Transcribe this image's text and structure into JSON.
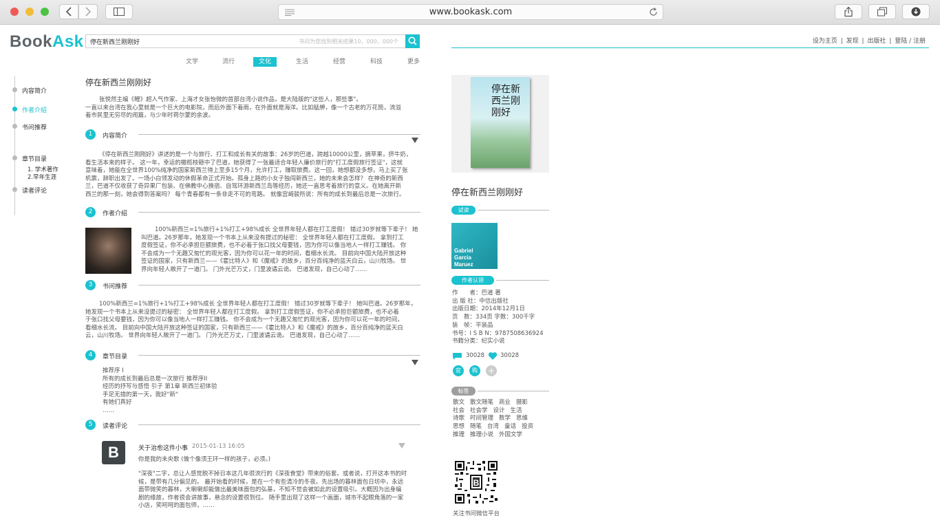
{
  "browser": {
    "url": "www.bookask.com"
  },
  "header": {
    "logo_book": "Book",
    "logo_ask": "Ask",
    "search_value": "停在新西兰刚刚好",
    "search_placeholder": "书问为您找到相关结果10，000，000个",
    "links": [
      "设为主页",
      "发现",
      "出版社",
      "登陆 / 注册"
    ],
    "separator": "|"
  },
  "categories": {
    "items": [
      "文学",
      "流行",
      "文化",
      "生活",
      "经营",
      "科技",
      "更多"
    ],
    "active_index": 2
  },
  "sidenav": {
    "items": [
      "内容简介",
      "作者介绍",
      "书问推荐",
      "章节目录",
      "1. 学术著作",
      "2.早年生涯",
      "读者评论"
    ],
    "active_index": 1
  },
  "book": {
    "title": "停在新西兰刚刚好",
    "intro": "张悦然主编《鲤》超人气作家、上海才女张怡微的首部台湾小说作品，是大陆版的\"这些人，那些事\"。",
    "intro_2": "一直以来台湾在我心里就是一个巨大的电影院，而后外面下着雨，在外面就是海洋。比如艋舺，像一个古老的万花筒，流溢",
    "intro_3": "着市民里无穷尽的闹篇，与少年时荷尔蒙的余波。"
  },
  "sections": {
    "s1": {
      "num": "1",
      "title": "内容简介",
      "lines": [
        "《停在新西兰刚刚好》讲述的是一个与旅行、打工和成长有关的故事：26岁的巴道，跨越10000公里，摘苹果，挤牛奶，",
        "看生活本来的样子。 这一年，幸运的橄榄枝砸中了巴道，她获得了一张最适合年轻人廉价旅行的\"打工度假旅行签证\"，这就",
        "意味着，她能在全世界100%纯净的国家新西兰待上至多15个月，允许打工，赚取旅费。这一回，她想都没多想，马上买了张",
        "机票，辞职出发了。一场小白领发动的休假革命正式开始。孤身上路的小女子独闯新西兰，她的未来会怎样？ 在神奇的新西",
        "兰，巴道不仅收获了奇异果厂包装、在佛教中心换宿、自驾环游新西兰岛等经历，她还一直思考着旅行的意义。在她离开新",
        "西兰的那一刻，她会得到答案吗？ 每个青春都有一条非走不可的弯路。 就像宫崎骏所说：所有的成长到最后总是一次旅行。"
      ]
    },
    "s2": {
      "num": "2",
      "title": "作者介绍",
      "lines": [
        "100%新西兰=1%旅行+1%打工+98%成长 全世界年轻人都在打工度假！ 错过30岁就等下辈子！ 她",
        "叫巴道。26岁那年，她发现一个书本上从来没有提过的秘密： 全世界年轻人都在打工度假。 拿到打工",
        "度假签证，你不必承担巨额旅费，也不必着于张口找父母要钱，因为你可以像当地人一样打工赚钱。 你",
        "不会成为一个无趣又匆忙的观光客，因为你可以花一年的时间，看细水长流。 目前向中国大陆开放这种",
        "签证的国家，只有新西兰——《霍比特人》和《魔戒》的故乡，百分百纯净的蓝天白云，山川牧场。 世",
        "界向年轻人敞开了一道门。 门外光芒万丈，门里波谲云诡。 巴道发现，自己心动了……"
      ]
    },
    "s3": {
      "num": "3",
      "title": "书问推荐",
      "lines": [
        "100%新西兰=1%旅行+1%打工+98%成长 全世界年轻人都在打工度假！ 错过30岁就等下辈子！ 她叫巴道。26岁那年，",
        "她发现一个书本上从来没提过的秘密： 全世界年轻人都在打工度假。 拿到打工度假签证，你不必承担巨额旅费，也不必着",
        "于张口找父母要钱，因为你可以像当地人一样打工赚钱。 你不会成为一个无趣又匆忙的观光客，因为你可以花一年的时间，",
        "看细水长流。 目前向中国大陆开放这种签证的国家，只有新西兰——《霍比特人》和《魔戒》的故乡，百分百纯净的蓝天白",
        "云，山川牧场。 世界向年轻人敞开了一道门。 门外光芒万丈，门里波谲云诡。 巴道发现，自己心动了……"
      ]
    },
    "s4": {
      "num": "4",
      "title": "章节目录",
      "lines": [
        "推荐序 I",
        "所有的成长到最后总是一次旅行 推荐序II",
        "经历的抒写与感悟 引子 第1章 新西兰初体验",
        "手足无措的第一天，我好\"新\"",
        "有她们真好",
        "……"
      ]
    },
    "s5": {
      "num": "5",
      "title": "读者评论"
    }
  },
  "review": {
    "avatar_letter": "B",
    "title": "关于治愈这件小事",
    "date": "2015-01-13 16:05",
    "subtitle": "你是我的未央歌 (做个像须王环一样的孩子，必须。)",
    "lines": [
      "\"深夜\"二字，总让人感觉脱不掉日本这几年很流行的《深夜食堂》带来的俗套。或者说，打开这本书的时",
      "候，是带有几分偏见的。 最开始看的时候，是在一个有些清冷的冬夜。先出场的暮林面包日坊中，永远",
      "面带微笑的暮林，大喇喇却能做出最美味面包的弘基，不知不觉会被如此的设置吸引。大概因为出身编",
      "剧的缘故，作者很会讲故事，悬念的设置很到位。 随手里出现了这样一个画面，城市不起眼角落的一家",
      "小店，笑呵呵的面包师，……"
    ]
  },
  "right": {
    "title": "停在新西兰刚刚好",
    "cover_title": "停在新西兰刚刚好",
    "trial_label": "试读",
    "trial_cover_text": [
      "Gabriel",
      "Garcia",
      "Maruez"
    ],
    "author_label": "作者认领",
    "meta": [
      "作　　者：巴道 著",
      "出 版 社：中信出版社",
      "出版日期：2014年12月1日",
      "页　数：334页 字数：300千字",
      "装　帧：平装品",
      "书号：I S B N：9787508636924",
      "书籍分类：纪实小说"
    ],
    "comments": "30028",
    "likes": "30028",
    "btn_guan": "官",
    "btn_gou": "购",
    "btn_plus": "+",
    "tags_label": "标签",
    "tags": [
      [
        "散文",
        "散文随笔",
        "商业",
        "摄影"
      ],
      [
        "社会",
        "社会学",
        "设计",
        "生活"
      ],
      [
        "诗歌",
        "时间管理",
        "数学",
        "思维"
      ],
      [
        "思想",
        "随笔",
        "台湾",
        "童话",
        "投资"
      ],
      [
        "推理",
        "推理小说",
        "外国文学"
      ]
    ],
    "qr_caption": "关注书问微信平台"
  },
  "colors": {
    "accent": "#1bc2cf"
  }
}
